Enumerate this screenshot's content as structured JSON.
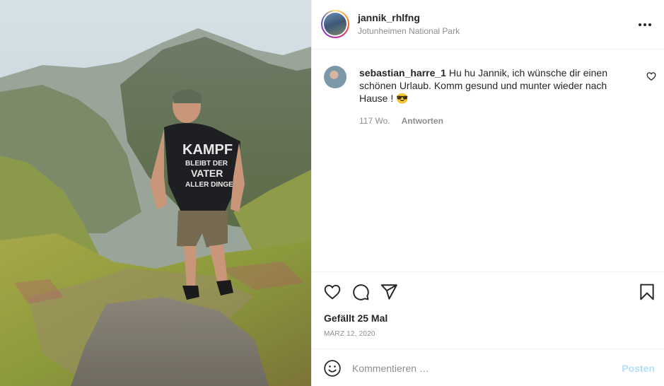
{
  "post": {
    "photo_icon": "landscape-photo",
    "shirt_text": [
      "KAMPF",
      "BLEIBT DER",
      "VATER",
      "ALLER DINGE"
    ]
  },
  "header": {
    "username": "jannik_rhlfng",
    "location": "Jotunheimen National Park",
    "more_icon": "more-horizontal-icon"
  },
  "comments": [
    {
      "username": "sebastian_harre_1",
      "text": "Hu hu Jannik, ich wünsche dir einen schönen Urlaub. Komm gesund und munter wieder nach Hause ! 😎",
      "age": "117 Wo.",
      "reply_label": "Antworten",
      "like_icon": "heart-outline-icon"
    }
  ],
  "actions": {
    "like_icon": "heart-icon",
    "comment_icon": "comment-icon",
    "share_icon": "paper-plane-icon",
    "save_icon": "bookmark-icon",
    "likes_text": "Gefällt 25 Mal",
    "date": "MÄRZ 12, 2020"
  },
  "add_comment": {
    "emoji_icon": "smiley-icon",
    "placeholder": "Kommentieren …",
    "post_label": "Posten",
    "post_color": "#b2dffc"
  },
  "colors": {
    "text": "#262626",
    "secondary": "#8e8e8e",
    "border": "#efefef"
  }
}
